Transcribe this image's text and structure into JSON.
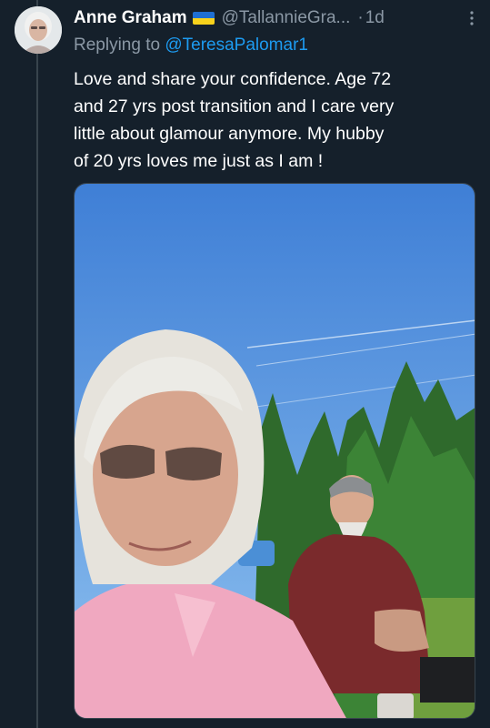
{
  "tweet": {
    "display_name": "Anne Graham",
    "handle": "@TallannieGra...",
    "separator": "·",
    "time": "1d",
    "reply_prefix": "Replying to",
    "reply_to": "@TeresaPalomar1",
    "text_lines": [
      "Love and share your confidence.  Age 72",
      "and 27 yrs post transition and I care very",
      "little about glamour anymore.  My hubby",
      "of 20 yrs loves me just as I am !"
    ],
    "flag_icon": "ukraine-flag-icon",
    "more_icon": "more-options-icon"
  },
  "colors": {
    "background": "#15202b",
    "text_primary": "#ffffff",
    "text_secondary": "#8b98a5",
    "link": "#1d9bf0",
    "flag_blue": "#1f6fd1",
    "flag_yellow": "#f7d21c"
  }
}
